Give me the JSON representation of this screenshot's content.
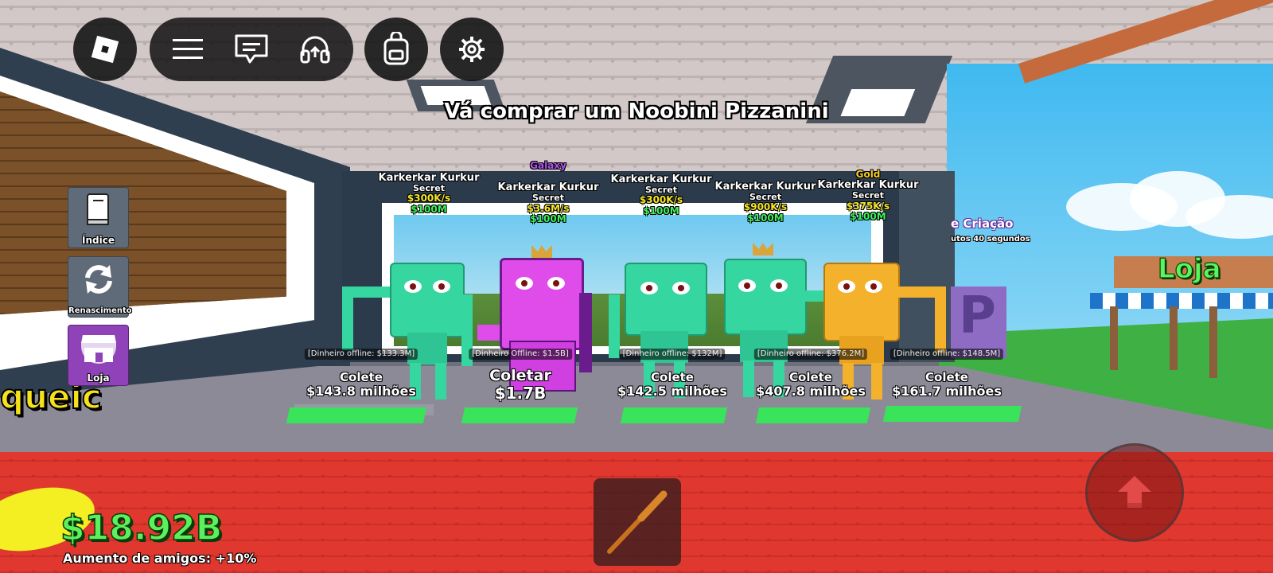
{
  "objective": "Vá comprar um Noobini Pizzanini",
  "topbar": {
    "roblox_icon": "roblox-logo-icon",
    "menu_icon": "hamburger-menu-icon",
    "chat_icon": "chat-bubble-icon",
    "voice_icon": "headset-icon",
    "backpack_icon": "backpack-icon",
    "settings_icon": "gear-icon"
  },
  "side_menu": [
    {
      "label": "Índice",
      "icon": "book-icon"
    },
    {
      "label": "Renascimento",
      "icon": "refresh-icon"
    },
    {
      "label": "Loja",
      "icon": "storefront-icon"
    }
  ],
  "billboards": [
    {
      "tag": "",
      "name": "Karkerkar Kurkur",
      "rarity": "Secret",
      "rate": "$300K/s",
      "price": "$100M"
    },
    {
      "tag": "Galaxy",
      "name": "Karkerkar Kurkur",
      "rarity": "Secret",
      "rate": "$3.6M/s",
      "price": "$100M"
    },
    {
      "tag": "",
      "name": "Karkerkar Kurkur",
      "rarity": "Secret",
      "rate": "$300K/s",
      "price": "$100M"
    },
    {
      "tag": "",
      "name": "Karkerkar Kurkur",
      "rarity": "Secret",
      "rate": "$900K/s",
      "price": "$100M"
    },
    {
      "tag": "Gold",
      "name": "Karkerkar Kurkur",
      "rarity": "Secret",
      "rate": "$375K/s",
      "price": "$100M"
    }
  ],
  "collect_pads": [
    {
      "offline": "[Dinheiro offline: $133.3M]",
      "label": "Colete",
      "amount": "$143.8 milhões"
    },
    {
      "offline": "[Dinheiro Offline: $1.5B]",
      "label": "Coletar",
      "amount": "$1.7B"
    },
    {
      "offline": "[Dinheiro offline: $132M]",
      "label": "Colete",
      "amount": "$142.5 milhões"
    },
    {
      "offline": "[Dinheiro offline: $376.2M]",
      "label": "Colete",
      "amount": "$407.8 milhões"
    },
    {
      "offline": "[Dinheiro offline: $148.5M]",
      "label": "Colete",
      "amount": "$161.7 milhões"
    }
  ],
  "world": {
    "creation_sign": "e Criação",
    "creation_timer": "utos 40 segundos",
    "shop_sign": "Loja",
    "left_partial_sign": "queic"
  },
  "hud": {
    "money": "$18.92B",
    "friends_boost": "Aumento de amigos: +10%",
    "tool_icon": "baseball-bat-icon",
    "jump_icon": "up-arrow-icon"
  },
  "colors": {
    "money_green": "#5cf05c",
    "rate_yellow": "#f5e626",
    "galaxy_purple": "#b054f0",
    "gold": "#f3cb2c",
    "carpet_red": "#df392f"
  }
}
